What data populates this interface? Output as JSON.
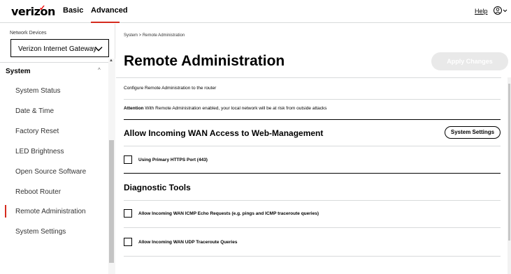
{
  "header": {
    "logo_text": "verizon",
    "logo_check": "✓",
    "tab_basic": "Basic",
    "tab_advanced": "Advanced",
    "help_label": "Help",
    "user_icon": "user-icon",
    "accent_color": "#d52b1e"
  },
  "sidebar": {
    "devices_label": "Network Devices",
    "device_value": "Verizon Internet Gateway",
    "section_label": "System",
    "items": [
      {
        "label": "System Status"
      },
      {
        "label": "Date & Time"
      },
      {
        "label": "Factory Reset"
      },
      {
        "label": "LED Brightness"
      },
      {
        "label": "Open Source Software"
      },
      {
        "label": "Reboot Router"
      },
      {
        "label": "Remote Administration"
      },
      {
        "label": "System Settings"
      }
    ],
    "active_item": "Remote Administration"
  },
  "main": {
    "breadcrumb": "System  >  Remote Administration",
    "title": "Remote Administration",
    "apply_label": "Apply Changes",
    "description": "Configure Remote Administration to the router",
    "attention_label": "Attention",
    "attention_text": " With Remote Administration enabled, your local network will be at risk from outside attacks",
    "wan_section_title": "Allow Incoming WAN Access to Web-Management",
    "system_settings_label": "System Settings",
    "https_label": "Using Primary HTTPS Port (443)",
    "diag_title": "Diagnostic Tools",
    "icmp_label": "Allow Incoming WAN ICMP Echo Requests (e.g. pings and ICMP traceroute queries)",
    "udp_label": "Allow Incoming WAN UDP Traceroute Queries"
  }
}
